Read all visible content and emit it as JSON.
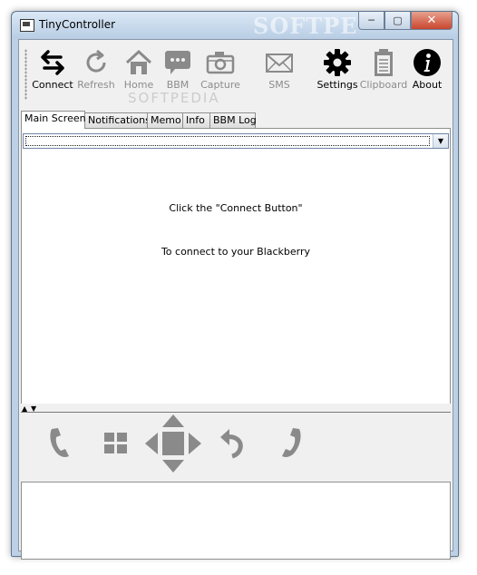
{
  "window": {
    "title": "TinyController",
    "watermark": "SOFTPE",
    "buttons": {
      "minimize": "─",
      "maximize": "▢",
      "close": "✕"
    }
  },
  "toolbar": {
    "watermark": "SOFTPEDIA",
    "items": [
      {
        "label": "Connect",
        "icon": "connect-arrows-icon",
        "enabled": true
      },
      {
        "label": "Refresh",
        "icon": "refresh-icon",
        "enabled": false
      },
      {
        "label": "Home",
        "icon": "home-icon",
        "enabled": false
      },
      {
        "label": "BBM",
        "icon": "bbm-chat-icon",
        "enabled": false
      },
      {
        "label": "Capture",
        "icon": "camera-icon",
        "enabled": false
      },
      {
        "label": "SMS",
        "icon": "envelope-icon",
        "enabled": false
      },
      {
        "label": "Settings",
        "icon": "gear-icon",
        "enabled": true
      },
      {
        "label": "Clipboard",
        "icon": "clipboard-icon",
        "enabled": false
      },
      {
        "label": "About",
        "icon": "info-icon",
        "enabled": true
      }
    ]
  },
  "tabs": [
    {
      "label": "Main Screen",
      "active": true
    },
    {
      "label": "Notifications",
      "active": false
    },
    {
      "label": "Memo",
      "active": false
    },
    {
      "label": "Info",
      "active": false
    },
    {
      "label": "BBM Log",
      "active": false
    }
  ],
  "main": {
    "combo_value": "",
    "message_line1": "Click the \"Connect Button\"",
    "message_line2": "To connect to your Blackberry"
  },
  "controls": [
    "call-icon",
    "menu-grid-icon",
    "dpad-icon",
    "back-icon",
    "hangup-icon"
  ],
  "colors": {
    "disabled_icon": "#8a8a8a",
    "active_icon": "#000000",
    "titlebar": "#c9d9ec"
  }
}
